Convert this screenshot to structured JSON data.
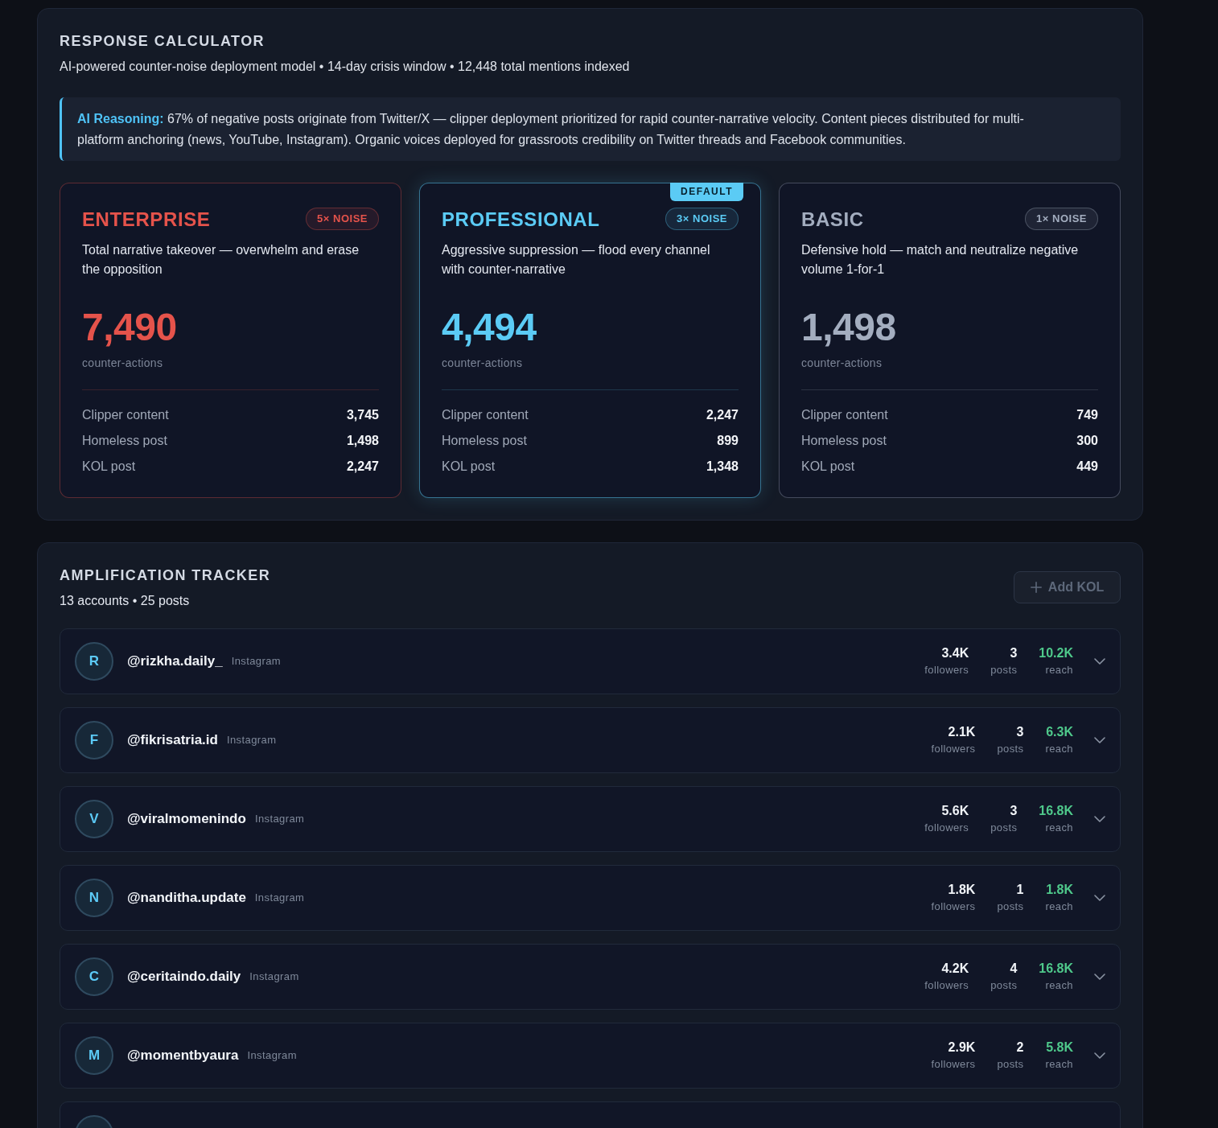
{
  "response_calculator": {
    "title": "RESPONSE CALCULATOR",
    "subtitle": "AI-powered counter-noise deployment model • 14-day crisis window • 12,448 total mentions indexed",
    "reasoning": "**AI Reasoning:** 67% of negative posts originate from Twitter/X — clipper deployment prioritized for rapid counter-narrative velocity. Content pieces distributed for multi-platform anchoring (news, YouTube, Instagram). Organic voices deployed for grassroots credibility on Twitter threads and Facebook communities.",
    "tiers": [
      {
        "name": "ENTERPRISE",
        "color": "#e5534b",
        "badge": "5× NOISE",
        "selected": false,
        "description": "Total narrative takeover — overwhelm and erase the opposition",
        "total": "7,490",
        "total_label": "counter-actions",
        "breakdown": [
          {
            "label": "Clipper content",
            "value": "3,745"
          },
          {
            "label": "Homeless post",
            "value": "1,498"
          },
          {
            "label": "KOL post",
            "value": "2,247"
          }
        ]
      },
      {
        "name": "PROFESSIONAL",
        "color": "#5bcbf5",
        "badge": "3× NOISE",
        "tag": "DEFAULT",
        "selected": true,
        "description": "Aggressive suppression — flood every channel with counter-narrative",
        "total": "4,494",
        "total_label": "counter-actions",
        "breakdown": [
          {
            "label": "Clipper content",
            "value": "2,247"
          },
          {
            "label": "Homeless post",
            "value": "899"
          },
          {
            "label": "KOL post",
            "value": "1,348"
          }
        ]
      },
      {
        "name": "BASIC",
        "color": "#a3adbf",
        "badge": "1× NOISE",
        "selected": false,
        "description": "Defensive hold — match and neutralize negative volume 1-for-1",
        "total": "1,498",
        "total_label": "counter-actions",
        "breakdown": [
          {
            "label": "Clipper content",
            "value": "749"
          },
          {
            "label": "Homeless post",
            "value": "300"
          },
          {
            "label": "KOL post",
            "value": "449"
          }
        ]
      }
    ]
  },
  "amplification_tracker": {
    "title": "AMPLIFICATION TRACKER",
    "subtitle": "13 accounts • 25 posts",
    "add_button": {
      "label": "Add KOL",
      "disabled": true
    },
    "accounts": [
      {
        "initial": "R",
        "handle": "@rizkha.daily_",
        "platform": "Instagram",
        "expanded": false,
        "stats": [
          {
            "value": "3.4K",
            "label": "followers",
            "accent": false
          },
          {
            "value": "3",
            "label": "posts",
            "accent": false
          },
          {
            "value": "10.2K",
            "label": "reach",
            "accent": true
          }
        ]
      },
      {
        "initial": "F",
        "handle": "@fikrisatria.id",
        "platform": "Instagram",
        "expanded": false,
        "stats": [
          {
            "value": "2.1K",
            "label": "followers",
            "accent": false
          },
          {
            "value": "3",
            "label": "posts",
            "accent": false
          },
          {
            "value": "6.3K",
            "label": "reach",
            "accent": true
          }
        ]
      },
      {
        "initial": "V",
        "handle": "@viralmomenindo",
        "platform": "Instagram",
        "expanded": false,
        "stats": [
          {
            "value": "5.6K",
            "label": "followers",
            "accent": false
          },
          {
            "value": "3",
            "label": "posts",
            "accent": false
          },
          {
            "value": "16.8K",
            "label": "reach",
            "accent": true
          }
        ]
      },
      {
        "initial": "N",
        "handle": "@nanditha.update",
        "platform": "Instagram",
        "expanded": false,
        "stats": [
          {
            "value": "1.8K",
            "label": "followers",
            "accent": false
          },
          {
            "value": "1",
            "label": "posts",
            "accent": false
          },
          {
            "value": "1.8K",
            "label": "reach",
            "accent": true
          }
        ]
      },
      {
        "initial": "C",
        "handle": "@ceritaindo.daily",
        "platform": "Instagram",
        "expanded": false,
        "stats": [
          {
            "value": "4.2K",
            "label": "followers",
            "accent": false
          },
          {
            "value": "4",
            "label": "posts",
            "accent": false
          },
          {
            "value": "16.8K",
            "label": "reach",
            "accent": true
          }
        ]
      },
      {
        "initial": "M",
        "handle": "@momentbyaura",
        "platform": "Instagram",
        "expanded": false,
        "stats": [
          {
            "value": "2.9K",
            "label": "followers",
            "accent": false
          },
          {
            "value": "2",
            "label": "posts",
            "accent": false
          },
          {
            "value": "5.8K",
            "label": "reach",
            "accent": true
          }
        ]
      }
    ],
    "more_rows_below": true
  }
}
